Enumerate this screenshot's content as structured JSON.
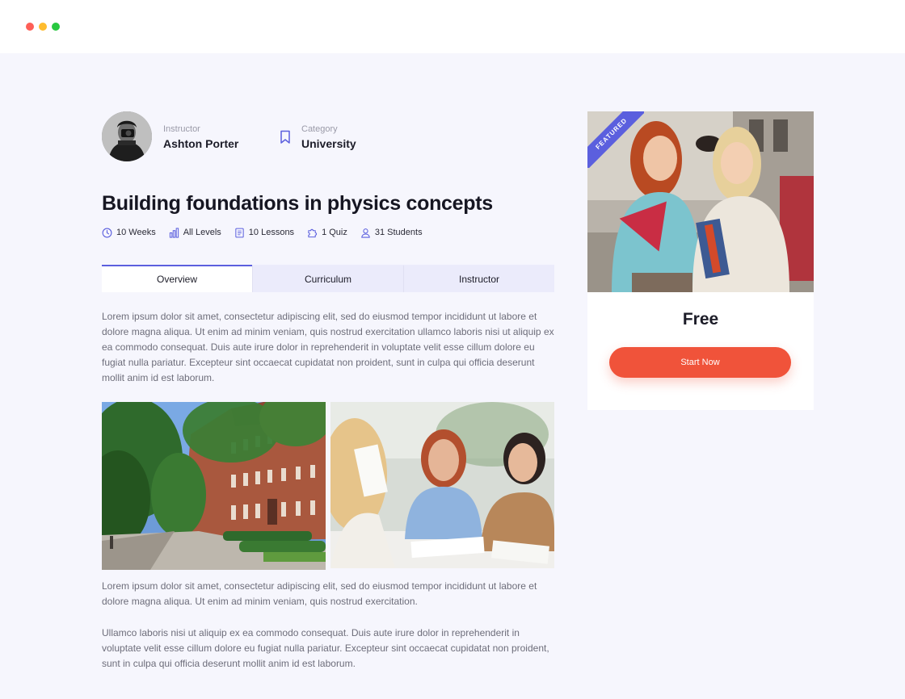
{
  "window": {
    "controls": [
      "close",
      "minimize",
      "maximize"
    ]
  },
  "instructor": {
    "label": "Instructor",
    "name": "Ashton Porter"
  },
  "category": {
    "label": "Category",
    "value": "University",
    "icon": "bookmark-icon"
  },
  "course": {
    "title": "Building foundations in physics concepts",
    "stats": [
      {
        "icon": "clock-icon",
        "text": "10 Weeks"
      },
      {
        "icon": "bar-chart-icon",
        "text": "All Levels"
      },
      {
        "icon": "book-icon",
        "text": "10 Lessons"
      },
      {
        "icon": "puzzle-icon",
        "text": "1 Quiz"
      },
      {
        "icon": "user-icon",
        "text": "31 Students"
      }
    ]
  },
  "tabs": [
    {
      "label": "Overview",
      "active": true
    },
    {
      "label": "Curriculum",
      "active": false
    },
    {
      "label": "Instructor",
      "active": false
    }
  ],
  "content": {
    "paragraph1": "Lorem ipsum dolor sit amet, consectetur adipiscing elit, sed do eiusmod tempor incididunt ut labore et dolore magna aliqua. Ut enim ad minim veniam, quis nostrud exercitation ullamco laboris nisi ut aliquip ex ea commodo consequat. Duis aute irure dolor in reprehenderit in voluptate velit esse cillum dolore eu fugiat nulla pariatur. Excepteur sint occaecat cupidatat non proident, sunt in culpa qui officia deserunt mollit anim id est laborum.",
    "paragraph2": "Lorem ipsum dolor sit amet, consectetur adipiscing elit, sed do eiusmod tempor incididunt ut labore et dolore magna aliqua. Ut enim ad minim veniam, quis nostrud exercitation.",
    "paragraph3": "Ullamco laboris nisi ut aliquip ex ea commodo consequat. Duis aute irure dolor in reprehenderit in voluptate velit esse cillum dolore eu fugiat nulla pariatur. Excepteur sint occaecat cupidatat non proident, sunt in culpa qui officia deserunt mollit anim id est laborum."
  },
  "sidebar": {
    "ribbon": "FEATURED",
    "price": "Free",
    "button_label": "Start Now"
  },
  "colors": {
    "accent": "#5b5fde",
    "cta": "#f0533a",
    "background": "#f6f6fd"
  }
}
